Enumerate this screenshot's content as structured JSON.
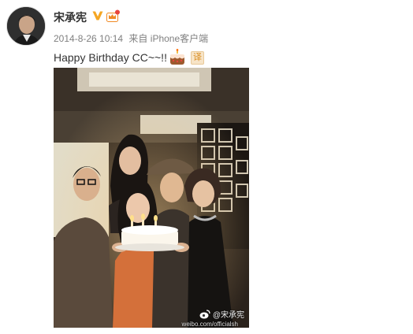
{
  "user": {
    "name": "宋承宪",
    "verified_icon": "verified-v-icon",
    "member_icon": "member-crown-icon"
  },
  "meta": {
    "time": "2014-8-26 10:14",
    "from_label": "来自",
    "source": "iPhone客户端"
  },
  "post": {
    "text": "Happy Birthday CC~~!!",
    "emoji": "cake-emoji",
    "translate_label": "译"
  },
  "photo": {
    "watermark": "@宋承宪",
    "watermark_url": "weibo.com/officialsh"
  },
  "colors": {
    "name": "#333333",
    "meta": "#808080",
    "verified_badge": "#f5a623",
    "translate_bg": "#f7e4c7"
  }
}
